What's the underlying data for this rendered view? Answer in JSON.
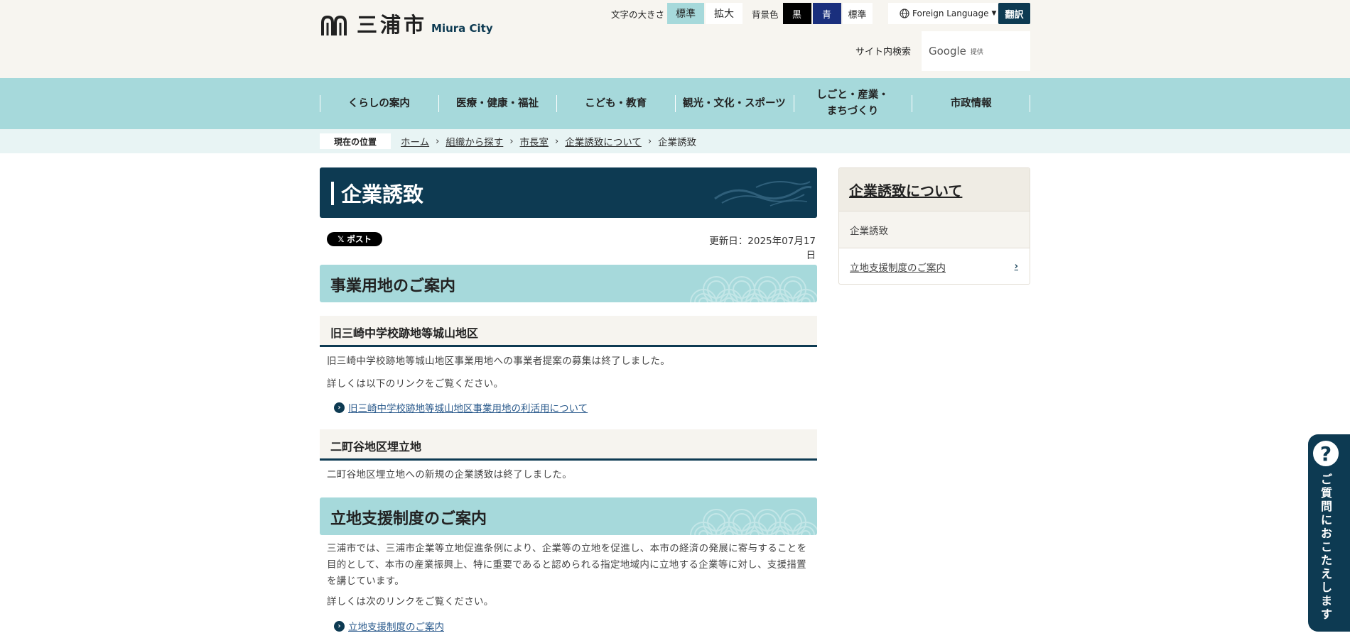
{
  "header": {
    "logo_ja": "三浦市",
    "logo_en": "Miura City",
    "font_size_label": "文字の大きさ",
    "font_size_standard": "標準",
    "font_size_large": "拡大",
    "bg_color_label": "背景色",
    "bg_black": "黒",
    "bg_blue": "青",
    "bg_standard": "標準",
    "foreign_language": "Foreign Language",
    "translate": "翻訳",
    "site_search_label": "サイト内検索",
    "search_brand": "Google",
    "search_brand_sub": "提供"
  },
  "nav": {
    "items": [
      {
        "label": "くらしの案内"
      },
      {
        "label": "医療・健康・福祉"
      },
      {
        "label": "こども・教育"
      },
      {
        "label": "観光・文化・スポーツ"
      },
      {
        "label": "しごと・産業・\nまちづくり"
      },
      {
        "label": "市政情報"
      }
    ]
  },
  "breadcrumb": {
    "here_label": "現在の位置",
    "links": [
      "ホーム",
      "組織から探す",
      "市長室",
      "企業誘致について"
    ],
    "current": "企業誘致"
  },
  "page": {
    "title": "企業誘致",
    "post_button": "ポスト",
    "updated": "更新日：2025年07月17日"
  },
  "content": {
    "h2_1": "事業用地のご案内",
    "h3_1": "旧三崎中学校跡地等城山地区",
    "p1": "旧三崎中学校跡地等城山地区事業用地への事業者提案の募集は終了しました。",
    "p2": "詳しくは以下のリンクをご覧ください。",
    "link1": "旧三崎中学校跡地等城山地区事業用地の利活用について",
    "h3_2": "二町谷地区埋立地",
    "p3": "二町谷地区埋立地への新規の企業誘致は終了しました。",
    "h2_2": "立地支援制度のご案内",
    "p4": "三浦市では、三浦市企業等立地促進条例により、企業等の立地を促進し、本市の経済の発展に寄与することを目的として、本市の産業振興上、特に重要であると認められる指定地域内に立地する企業等に対し、支援措置を講じています。",
    "p5": "詳しくは次のリンクをご覧ください。",
    "link2": "立地支援制度のご案内"
  },
  "sidebar": {
    "heading": "企業誘致について",
    "items": [
      {
        "label": "企業誘致"
      },
      {
        "label": "立地支援制度のご案内"
      }
    ]
  },
  "help": {
    "label": "ご質問におこたえします"
  },
  "colors": {
    "navy": "#0d3a52",
    "teal": "#a6d9db",
    "cream": "#f7f5f0"
  }
}
